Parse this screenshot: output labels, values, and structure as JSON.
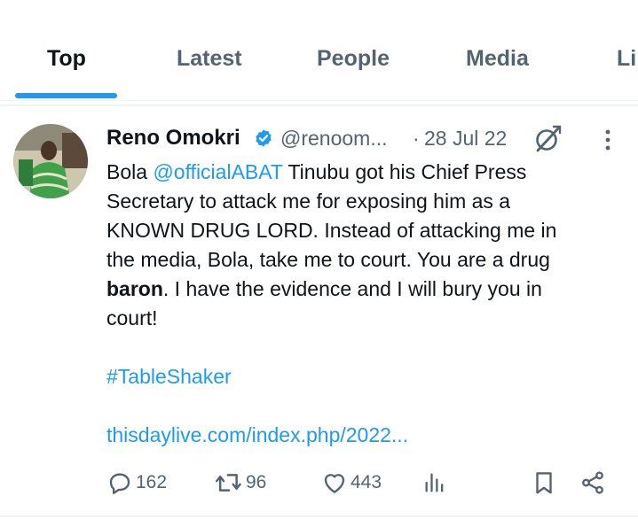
{
  "tabs": [
    {
      "label": "Top",
      "active": true
    },
    {
      "label": "Latest",
      "active": false
    },
    {
      "label": "People",
      "active": false
    },
    {
      "label": "Media",
      "active": false
    },
    {
      "label": "Li",
      "active": false
    }
  ],
  "tweet": {
    "author_name": "Reno Omokri",
    "verified": true,
    "handle": "@renoom...",
    "separator": "·",
    "timestamp": "28 Jul 22",
    "text_lines": {
      "l1_pre": "Bola ",
      "l1_mention": "@officialABAT",
      "l1_post": " Tinubu got his Chief Press",
      "l2": "Secretary to attack me for exposing him as a",
      "l3": "KNOWN DRUG LORD. Instead of attacking me in",
      "l4": "the media, Bola, take me to court. You are a drug",
      "l5_bold": "baron",
      "l5_post": ". I have the evidence and I will bury you in",
      "l6": "court!"
    },
    "hashtag": "#TableShaker",
    "link": "thisdaylive.com/index.php/2022...",
    "stats": {
      "replies": "162",
      "reposts": "96",
      "likes": "443"
    }
  },
  "colors": {
    "accent": "#1d9bf0",
    "text_primary": "#0f1419",
    "text_secondary": "#536471",
    "divider": "#eff3f4"
  },
  "icons": [
    "verified-badge-icon",
    "grok-icon",
    "more-options-icon",
    "reply-icon",
    "repost-icon",
    "like-icon",
    "views-icon",
    "bookmark-icon",
    "share-icon"
  ]
}
